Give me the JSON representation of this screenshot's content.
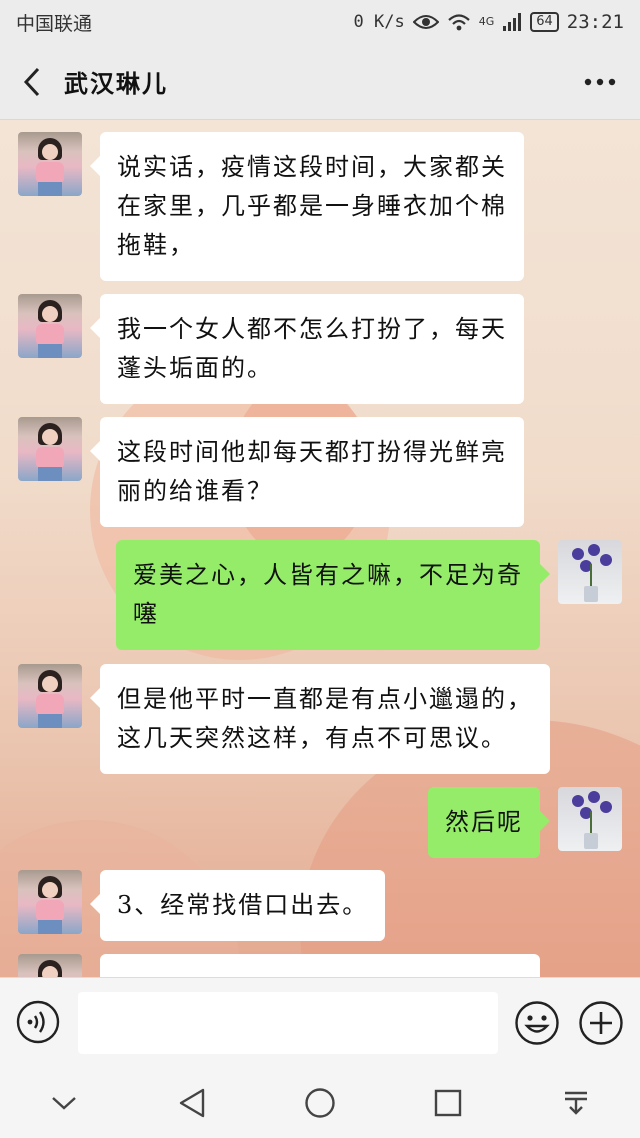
{
  "status_bar": {
    "carrier": "中国联通",
    "speed": "0 K/s",
    "network": "4G",
    "battery": "64",
    "time": "23:21"
  },
  "header": {
    "title": "武汉琳儿",
    "back_icon": "chevron-left-icon",
    "more_icon": "more-dots-icon"
  },
  "messages": [
    {
      "side": "left",
      "text": "说实话，疫情这段时间，大家都关在家里，几乎都是一身睡衣加个棉拖鞋，",
      "lines": [
        "说实话，疫情这段时间，大家都关",
        "在家里，几乎都是一身睡衣加个棉",
        "拖鞋，"
      ]
    },
    {
      "side": "left",
      "text": "我一个女人都不怎么打扮了，每天蓬头垢面的。",
      "lines": [
        "我一个女人都不怎么打扮了，每天",
        "蓬头垢面的。"
      ]
    },
    {
      "side": "left",
      "text": "这段时间他却每天都打扮得光鲜亮丽的给谁看？",
      "lines": [
        "这段时间他却每天都打扮得光鲜亮",
        "丽的给谁看？"
      ]
    },
    {
      "side": "right",
      "text": "爱美之心，人皆有之嘛，不足为奇噻",
      "lines": [
        "爱美之心，人皆有之嘛，不足为奇",
        "噻"
      ]
    },
    {
      "side": "left",
      "text": "但是他平时一直都是有点小邋遢的，这几天突然这样，有点不可思议。",
      "lines": [
        "但是他平时一直都是有点小邋遢的，",
        "这几天突然这样，有点不可思议。"
      ]
    },
    {
      "side": "right",
      "text": "然后呢",
      "lines": [
        "然后呢"
      ]
    },
    {
      "side": "left",
      "text": "3、经常找借口出去。",
      "lines": [
        "3、经常找借口出去。"
      ]
    }
  ],
  "input_bar": {
    "voice_icon": "voice-icon",
    "placeholder": "",
    "emoji_icon": "emoji-icon",
    "plus_icon": "plus-icon"
  },
  "nav_bar": {
    "icons": [
      "chevron-down-icon",
      "back-triangle-icon",
      "home-circle-icon",
      "recents-square-icon",
      "notification-pull-icon"
    ]
  },
  "colors": {
    "sent_bubble": "#95ec69",
    "received_bubble": "#ffffff",
    "bar_background": "#ececec"
  }
}
